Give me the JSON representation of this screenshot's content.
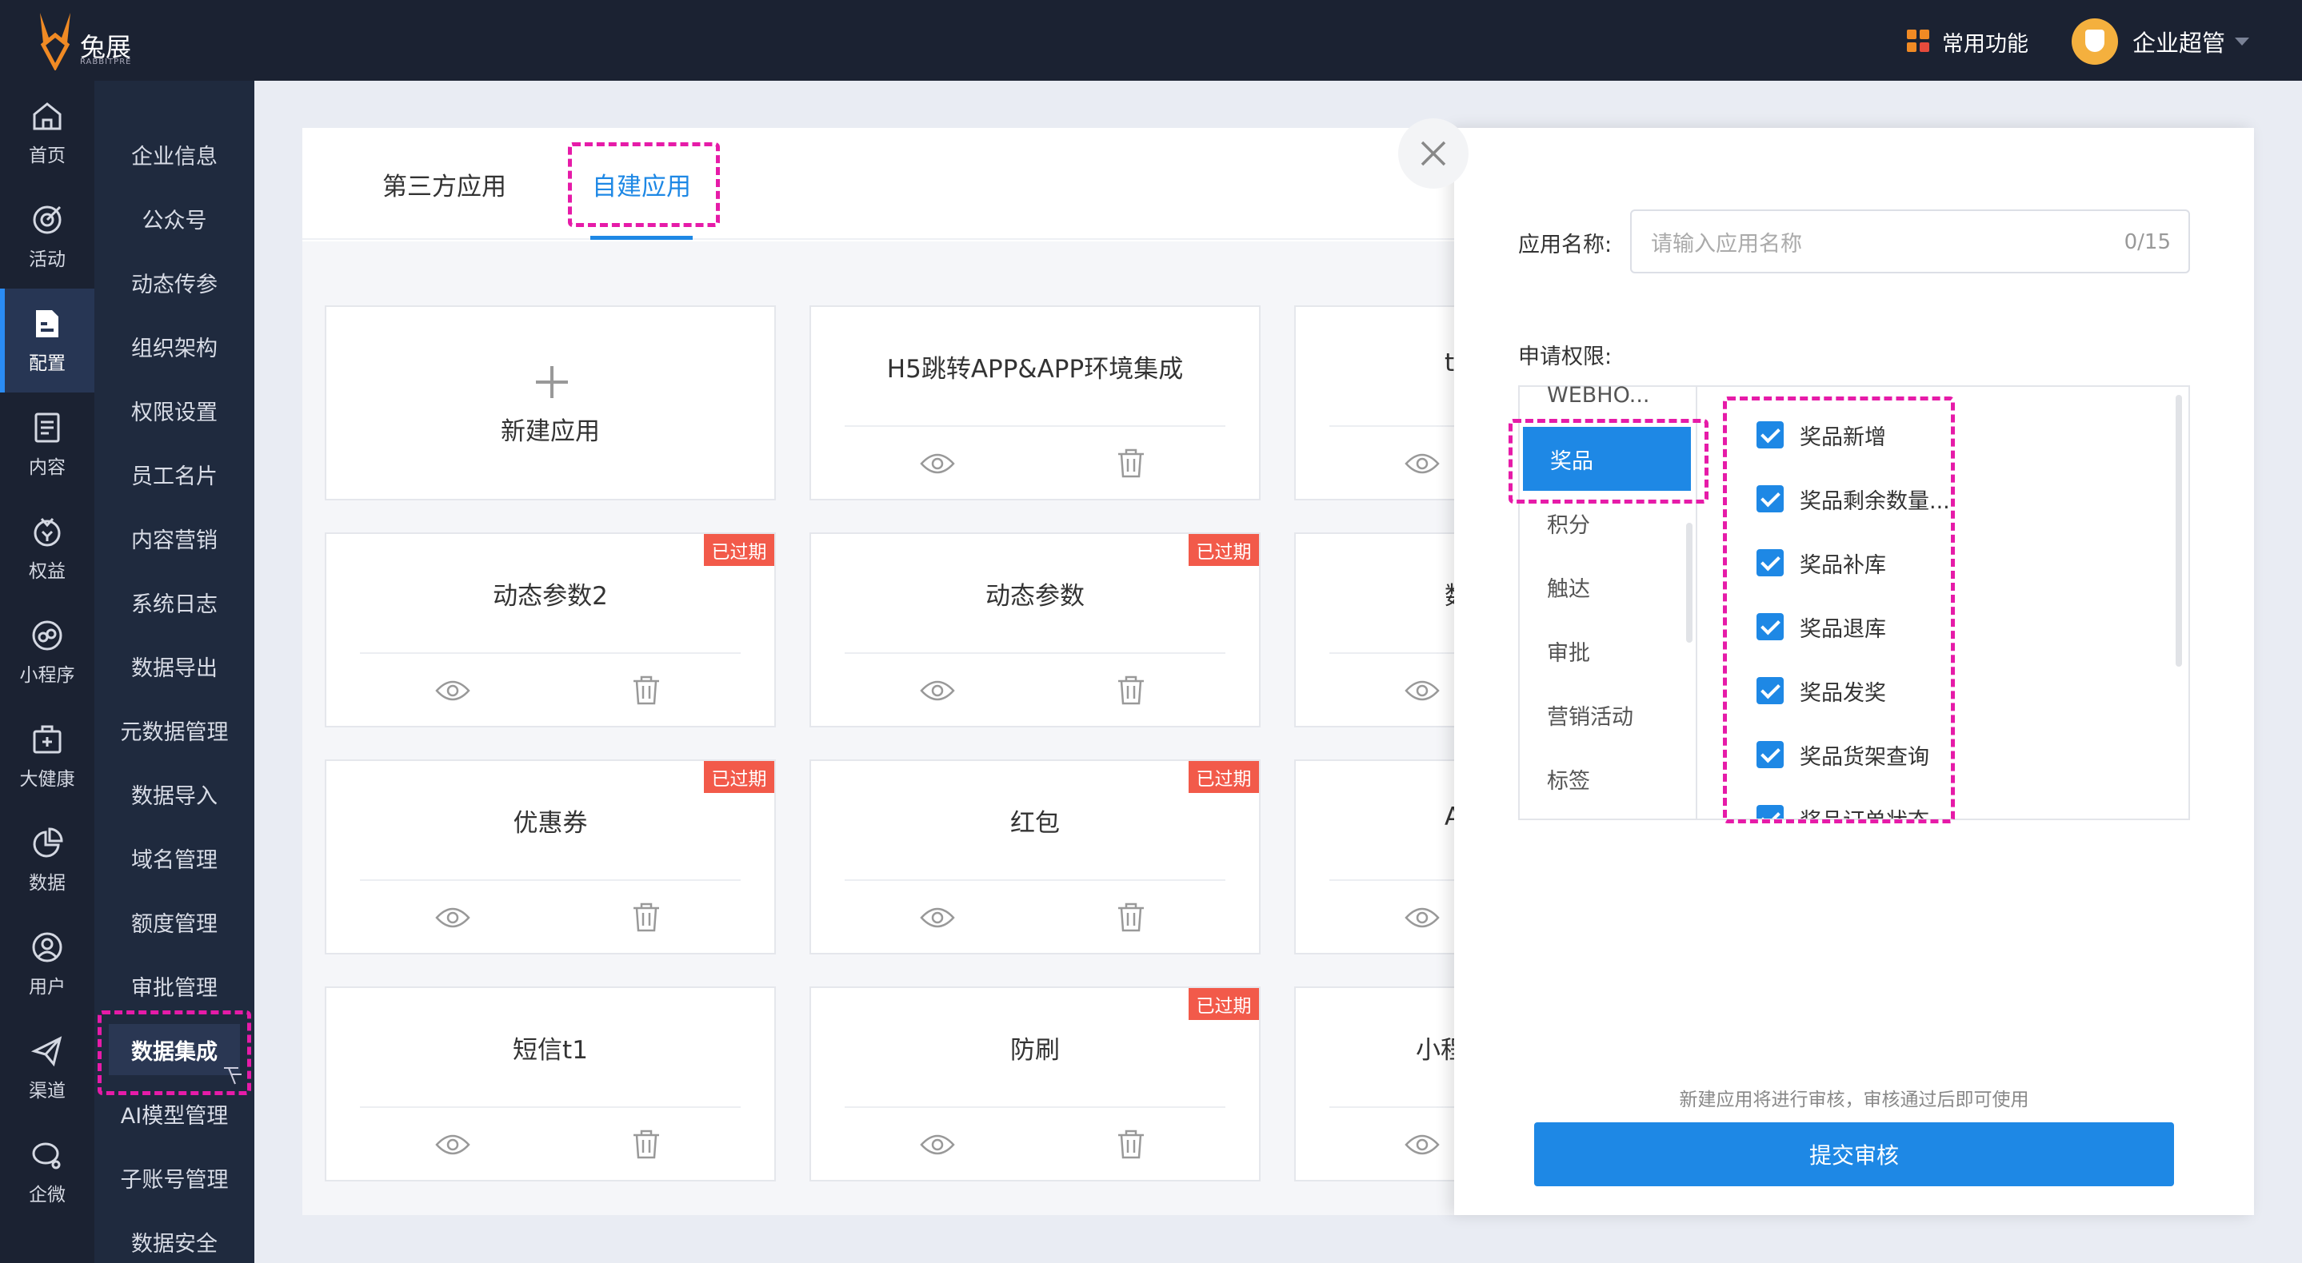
{
  "brand": {
    "name": "兔展",
    "sub": "RABBITPRE"
  },
  "topbar": {
    "quick_label": "常用功能",
    "user_name": "企业超管"
  },
  "rail": [
    {
      "label": "首页",
      "icon": "home-icon"
    },
    {
      "label": "活动",
      "icon": "target-icon"
    },
    {
      "label": "配置",
      "icon": "config-icon"
    },
    {
      "label": "内容",
      "icon": "document-icon"
    },
    {
      "label": "权益",
      "icon": "gift-icon"
    },
    {
      "label": "小程序",
      "icon": "mini-program-icon"
    },
    {
      "label": "大健康",
      "icon": "medical-kit-icon"
    },
    {
      "label": "数据",
      "icon": "pie-chart-icon"
    },
    {
      "label": "用户",
      "icon": "user-icon"
    },
    {
      "label": "渠道",
      "icon": "paper-plane-icon"
    },
    {
      "label": "企微",
      "icon": "chat-icon"
    }
  ],
  "subnav": [
    "企业信息",
    "公众号",
    "动态传参",
    "组织架构",
    "权限设置",
    "员工名片",
    "内容营销",
    "系统日志",
    "数据导出",
    "元数据管理",
    "数据导入",
    "域名管理",
    "额度管理",
    "审批管理",
    "数据集成",
    "AI模型管理",
    "子账号管理",
    "数据安全"
  ],
  "tabs": [
    "第三方应用",
    "自建应用"
  ],
  "cards": {
    "new_label": "新建应用",
    "expired_badge": "已过期",
    "items": [
      "H5跳转APP&APP环境集成",
      "te",
      "动态参数2",
      "动态参数",
      "数",
      "优惠券",
      "红包",
      "A",
      "短信t1",
      "防刷",
      "小程"
    ]
  },
  "drawer": {
    "name_label": "应用名称:",
    "name_placeholder": "请输入应用名称",
    "name_count": "0/15",
    "perm_label": "申请权限:",
    "categories": [
      "WEBHO...",
      "奖品",
      "积分",
      "触达",
      "审批",
      "营销活动",
      "标签"
    ],
    "permissions": [
      "奖品新增",
      "奖品剩余数量...",
      "奖品补库",
      "奖品退库",
      "奖品发奖",
      "奖品货架查询",
      "奖品订单状态"
    ],
    "notice": "新建应用将进行审核，审核通过后即可使用",
    "submit_label": "提交审核"
  },
  "colors": {
    "accent": "#1e88e5",
    "sidebar": "#1b2232",
    "highlight": "#e61ba8",
    "expired": "#f25a4a"
  }
}
